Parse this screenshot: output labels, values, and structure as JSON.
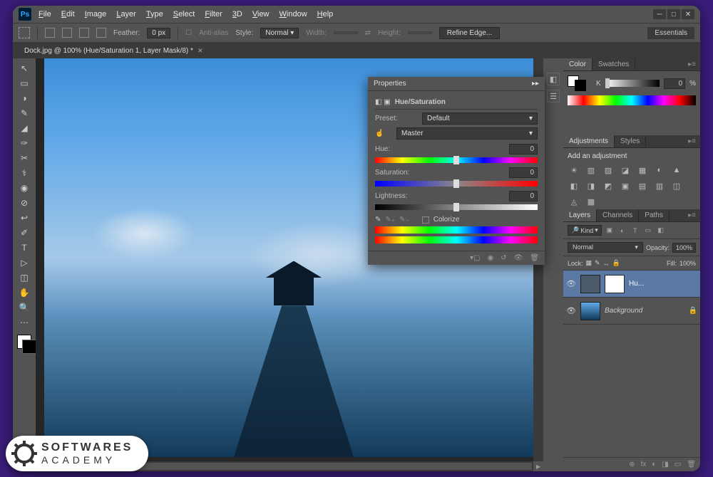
{
  "app": {
    "logo": "Ps"
  },
  "menu": [
    "File",
    "Edit",
    "Image",
    "Layer",
    "Type",
    "Select",
    "Filter",
    "3D",
    "View",
    "Window",
    "Help"
  ],
  "options": {
    "feather_label": "Feather:",
    "feather_value": "0 px",
    "antialias_label": "Anti-alias",
    "style_label": "Style:",
    "style_value": "Normal",
    "width_label": "Width:",
    "height_label": "Height:",
    "refine_label": "Refine Edge...",
    "essentials": "Essentials"
  },
  "document": {
    "tab_title": "Dock.jpg @ 100% (Hue/Saturation 1, Layer Mask/8) *"
  },
  "tools": [
    "↖",
    "▭",
    "◑",
    "✎",
    "◢",
    "✑",
    "✂",
    "⚕",
    "◉",
    "⊘",
    "↩",
    "✐",
    "T",
    "▷",
    "◫",
    "✋",
    "🔍",
    "⋯"
  ],
  "right_icons": [
    "◧",
    "☰"
  ],
  "properties_panel": {
    "tab": "Properties",
    "title": "Hue/Saturation",
    "preset_label": "Preset:",
    "preset_value": "Default",
    "channel_value": "Master",
    "hue_label": "Hue:",
    "hue_value": "0",
    "sat_label": "Saturation:",
    "sat_value": "0",
    "light_label": "Lightness:",
    "light_value": "0",
    "colorize_label": "Colorize"
  },
  "color_panel": {
    "tabs": [
      "Color",
      "Swatches"
    ],
    "k_label": "K",
    "k_value": "0",
    "k_unit": "%"
  },
  "adjustments_panel": {
    "tabs": [
      "Adjustments",
      "Styles"
    ],
    "title": "Add an adjustment",
    "icons": [
      "☀",
      "▥",
      "▨",
      "◪",
      "▦",
      "◐",
      "▲",
      "◧",
      "◨",
      "◩",
      "▣",
      "▤",
      "▥",
      "◫",
      "◬",
      "▩"
    ]
  },
  "layers_panel": {
    "tabs": [
      "Layers",
      "Channels",
      "Paths"
    ],
    "kind_label": "Kind",
    "filter_icons": [
      "▣",
      "◐",
      "T",
      "▭",
      "◧"
    ],
    "blend_mode": "Normal",
    "opacity_label": "Opacity:",
    "opacity_value": "100%",
    "lock_label": "Lock:",
    "lock_icons": [
      "▦",
      "✎",
      "↔",
      "🔒"
    ],
    "fill_label": "Fill:",
    "fill_value": "100%",
    "layers": [
      {
        "name": "Hu...",
        "selected": true,
        "has_mask": true,
        "locked": false
      },
      {
        "name": "Background",
        "selected": false,
        "has_mask": false,
        "locked": true
      }
    ],
    "footer_icons": [
      "⊕",
      "fx",
      "◐",
      "◨",
      "▭",
      "🗑"
    ]
  },
  "watermark": {
    "line1": "SOFTWARES",
    "line2": "ACADEMY"
  }
}
